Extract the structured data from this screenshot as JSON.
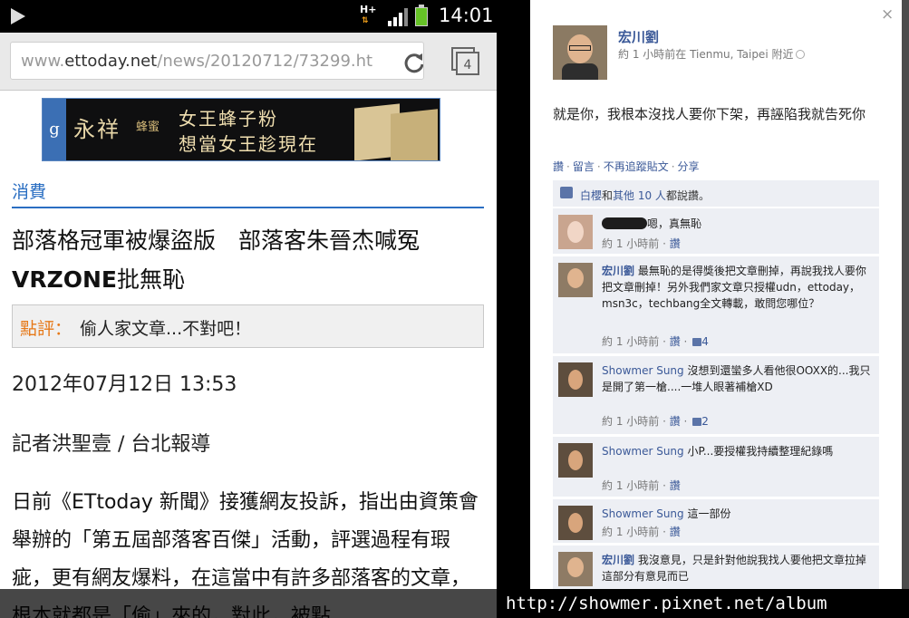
{
  "status_bar": {
    "network": "H+",
    "time": "14:01"
  },
  "browser": {
    "url_host_prefix": "www.",
    "url_host": "ettoday.net",
    "url_path": "/news/20120712/73299.ht",
    "tab_count": "4"
  },
  "ad": {
    "logo_letter": "g",
    "brand": "永祥",
    "brand_sub": "蜂蜜",
    "line1": "女王蜂子粉",
    "line2": "想當女王趁現在"
  },
  "article": {
    "category": "消費",
    "headline_part1": "部落格冠軍被爆盜版　部落客朱晉杰喊冤　",
    "headline_bold": "VRZONE",
    "headline_part2": "批無恥",
    "comment_label": "點評：",
    "comment_text": "偷人家文章...不對吧！",
    "date": "2012年07月12日 13:53",
    "reporter": "記者洪聖壹 / 台北報導",
    "body": "日前《ETtoday 新聞》接獲網友投訴，指出由資策會舉辦的「第五屆部落客百傑」活動，評選過程有瑕疵，更有網友爆料，在這當中有許多部落客的文章，根本就都是「偷」來的，對此，被點"
  },
  "watermark": "http://showmer.pixnet.net/album",
  "facebook": {
    "close": "×",
    "author": "宏川劉",
    "meta": "約 1 小時前在 Tienmu, Taipei 附近",
    "post": "就是你，我根本沒找人要你下架，再誣陷我就告死你",
    "actions": [
      "讚",
      "留言",
      "不再追蹤貼文",
      "分享"
    ],
    "likes_name": "白櫻",
    "likes_mid": "和",
    "likes_others": "其他 10 人",
    "likes_end": "都說讚。",
    "comments": [
      {
        "name": "",
        "text": "嗯，真無恥",
        "time": "約 1 小時前",
        "like": "讚",
        "likes": ""
      },
      {
        "name": "宏川劉",
        "text": "最無恥的是得獎後把文章刪掉，再說我找人要你把文章刪掉！另外我們家文章只授權udn，ettoday，msn3c，techbang全文轉載，敢問您哪位？",
        "time": "約 1 小時前",
        "like": "讚",
        "likes": "4"
      },
      {
        "name": "Showmer Sung",
        "text": "沒想到還蠻多人看他很OOXX的...我只是開了第一槍....一堆人眼著補槍XD",
        "time": "約 1 小時前",
        "like": "讚",
        "likes": "2"
      },
      {
        "name": "Showmer Sung",
        "text": "小P...要授權我持續整理紀錄嗎",
        "time": "約 1 小時前",
        "like": "讚",
        "likes": ""
      },
      {
        "name": "Showmer Sung",
        "text": "這一部份",
        "time": "約 1 小時前",
        "like": "讚",
        "likes": ""
      },
      {
        "name": "宏川劉",
        "text": "我沒意見，只是針對他說我找人要他把文章拉掉這部分有意見而已",
        "time": "",
        "like": "",
        "likes": ""
      }
    ]
  }
}
